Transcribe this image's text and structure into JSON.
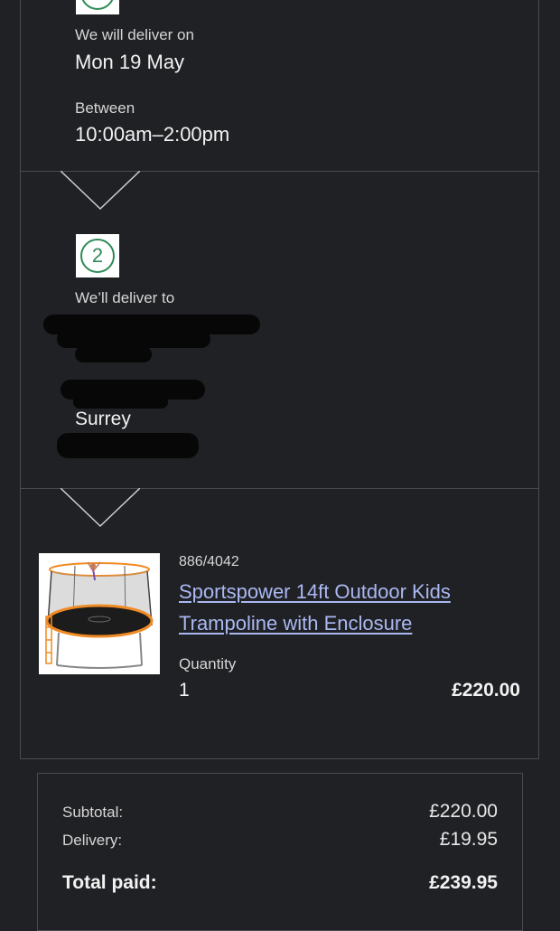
{
  "delivery": {
    "date_label": "We will deliver on",
    "date": "Mon 19 May",
    "time_label": "Between",
    "time": "10:00am–2:00pm"
  },
  "address": {
    "step_number": "2",
    "label": "We’ll deliver to",
    "county": "Surrey"
  },
  "product": {
    "code": "886/4042",
    "name_line1": "Sportspower 14ft Outdoor Kids",
    "name_line2": "Trampoline with Enclosure",
    "quantity_label": "Quantity",
    "quantity": "1",
    "price": "£220.00"
  },
  "summary": {
    "subtotal_label": "Subtotal:",
    "subtotal": "£220.00",
    "delivery_label": "Delivery:",
    "delivery": "£19.95",
    "total_label": "Total paid:",
    "total": "£239.95"
  },
  "colors": {
    "background": "#202124",
    "link": "#aab8f2",
    "step_accent": "#2e8b57"
  }
}
